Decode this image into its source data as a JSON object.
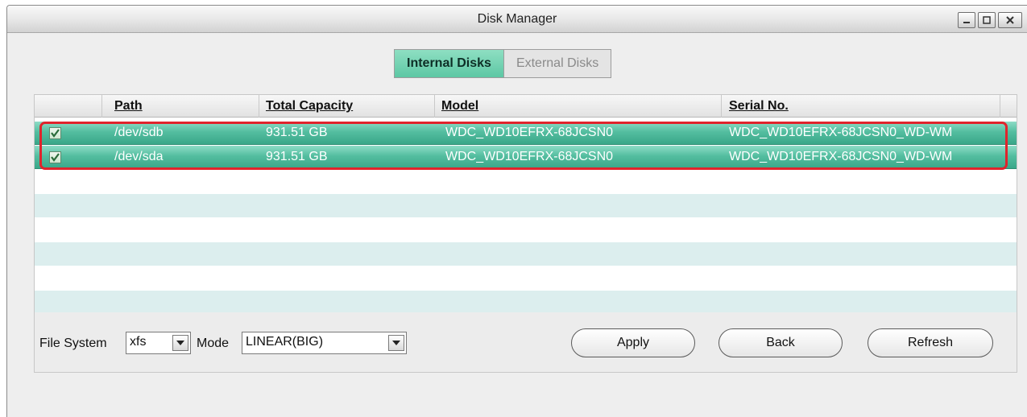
{
  "window": {
    "title": "Disk Manager"
  },
  "tabs": [
    {
      "label": "Internal Disks",
      "active": true
    },
    {
      "label": "External Disks",
      "active": false
    }
  ],
  "table": {
    "columns": [
      "Path",
      "Total Capacity",
      "Model",
      "Serial No."
    ],
    "rows": [
      {
        "checked": true,
        "path": "/dev/sdb",
        "capacity": "931.51 GB",
        "model": "WDC_WD10EFRX-68JCSN0",
        "serial": "WDC_WD10EFRX-68JCSN0_WD-WM"
      },
      {
        "checked": true,
        "path": "/dev/sda",
        "capacity": "931.51 GB",
        "model": "WDC_WD10EFRX-68JCSN0",
        "serial": "WDC_WD10EFRX-68JCSN0_WD-WM"
      }
    ]
  },
  "form": {
    "file_system_label": "File System",
    "file_system_value": "xfs",
    "mode_label": "Mode",
    "mode_value": "LINEAR(BIG)"
  },
  "buttons": {
    "apply": "Apply",
    "back": "Back",
    "refresh": "Refresh"
  },
  "colors": {
    "selection": "#54bea0",
    "highlight_box": "#e0242c",
    "stripe": "#dceeee"
  },
  "icons": {
    "minimize": "minimize-icon",
    "maximize": "maximize-icon",
    "close": "close-icon",
    "checkbox": "checkbox-checked-icon",
    "dropdown": "chevron-down-icon"
  }
}
